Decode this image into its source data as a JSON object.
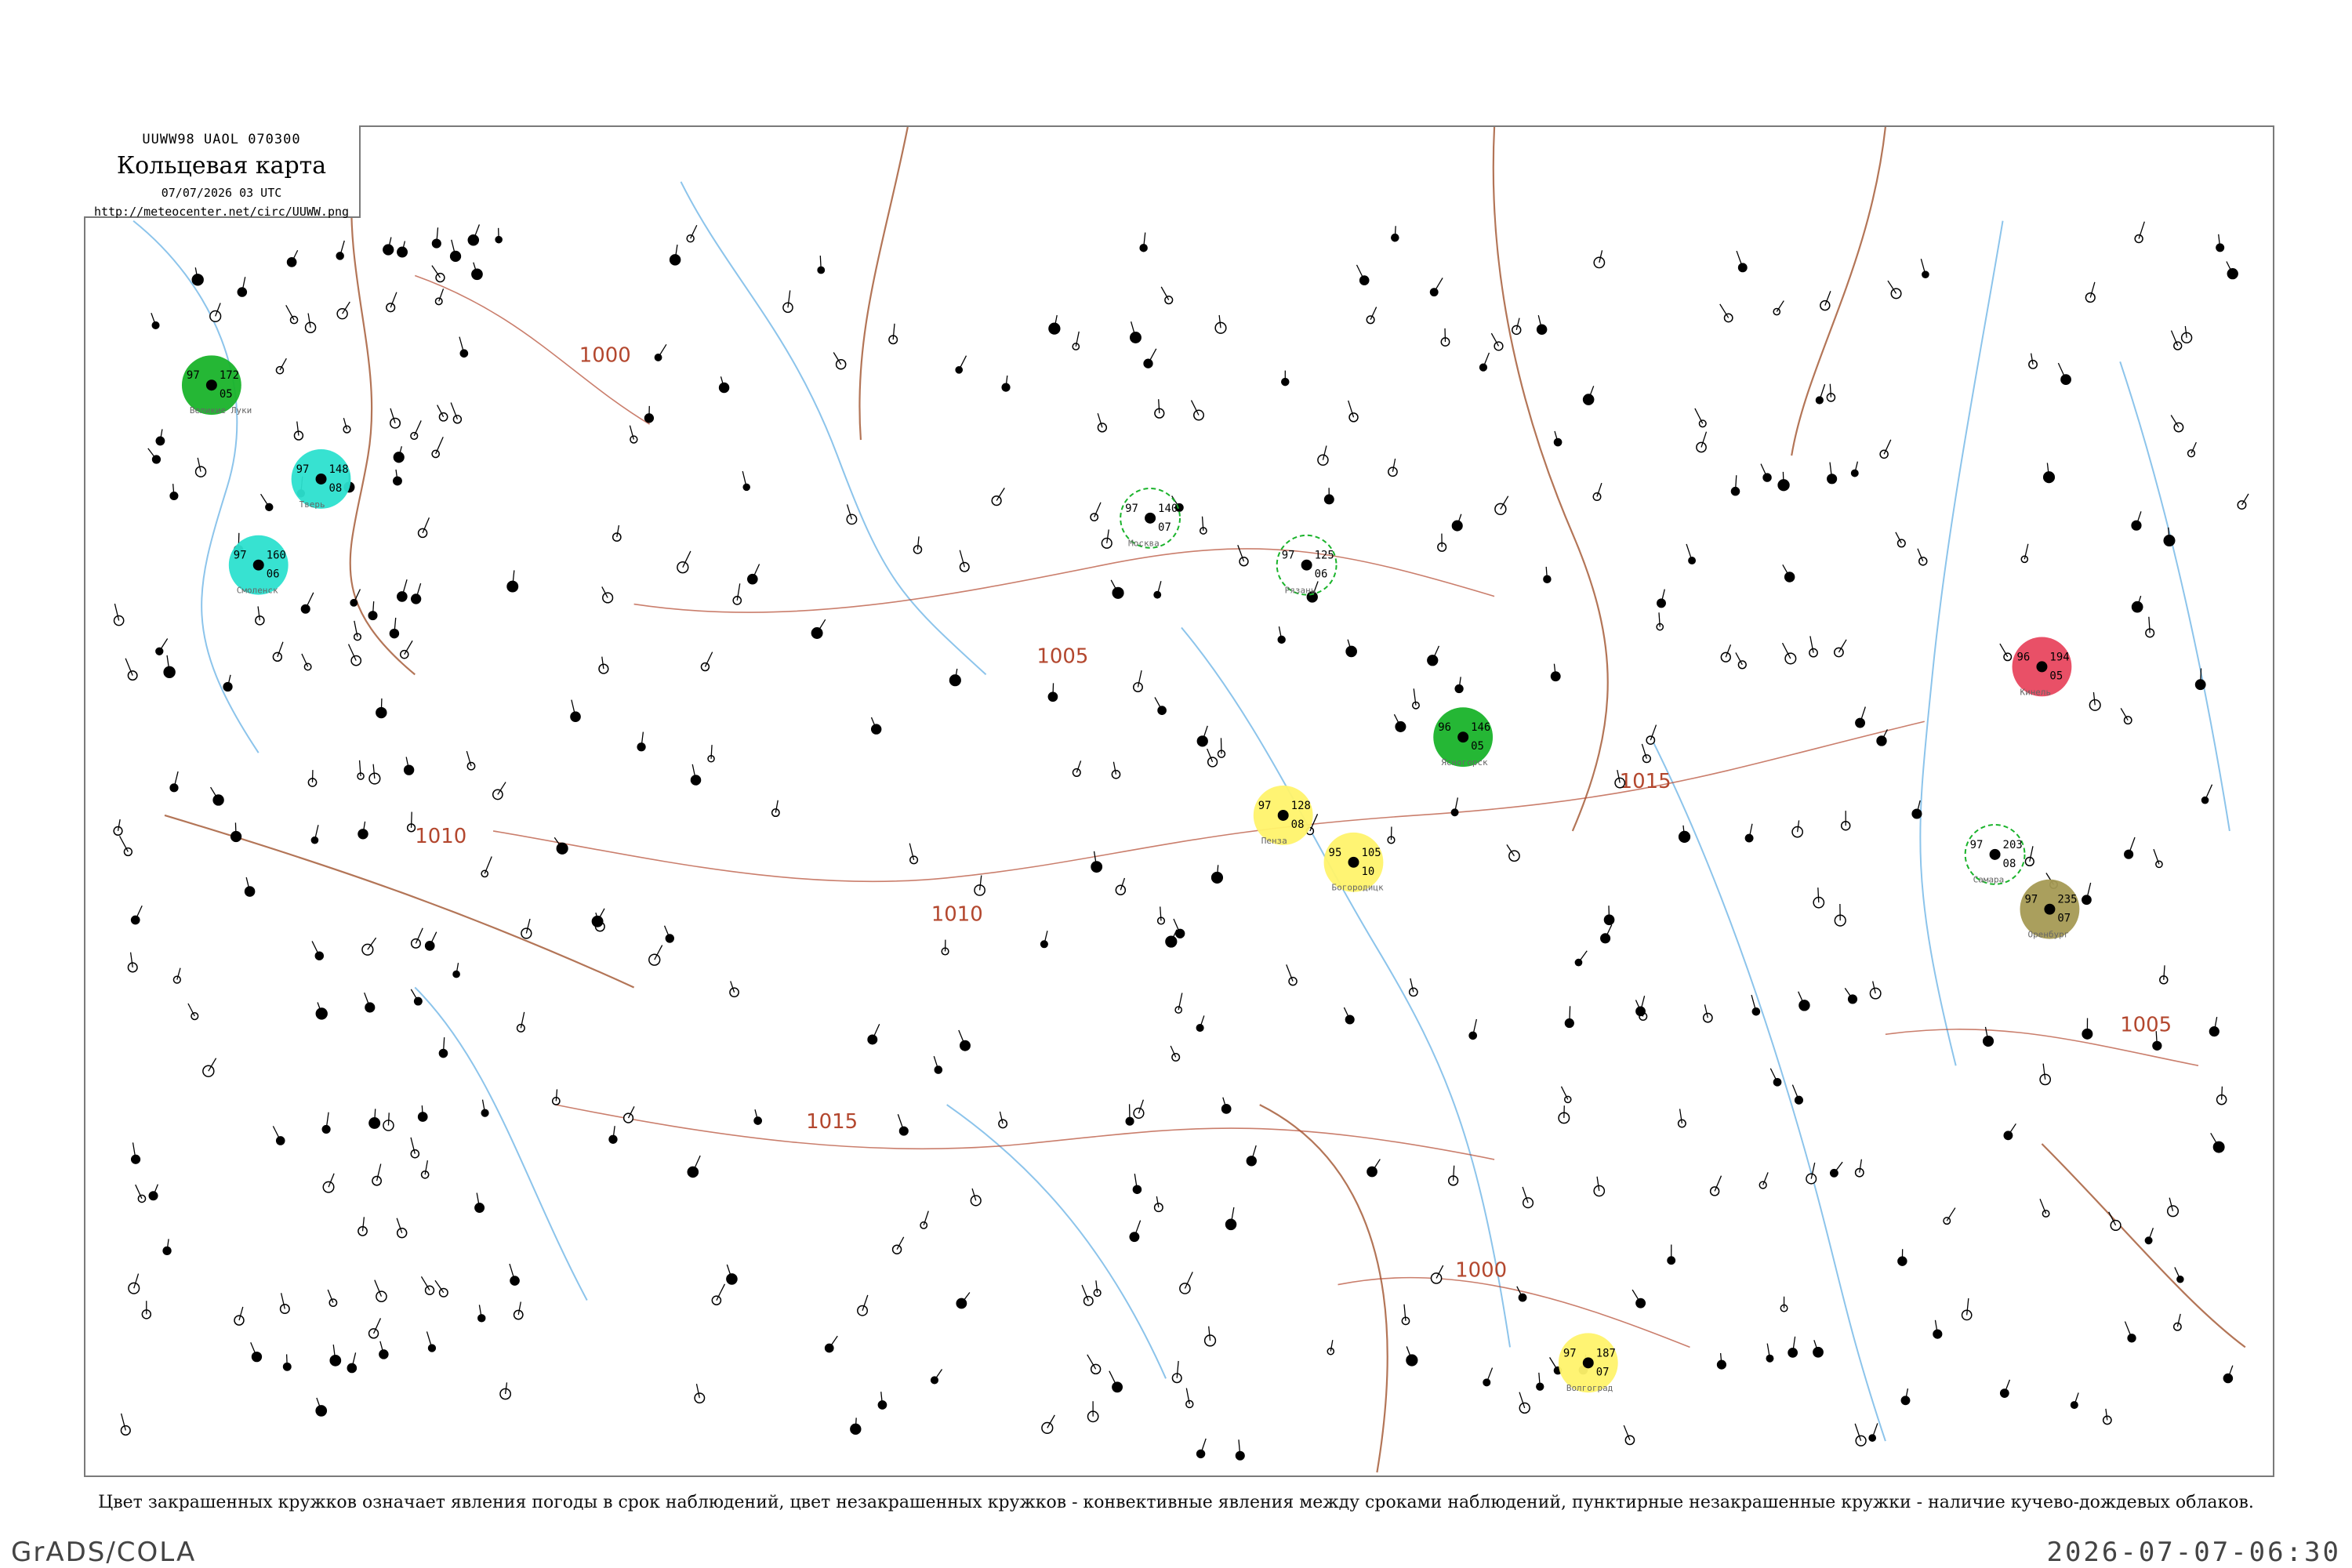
{
  "map": {
    "header_code": "UUWW98  UAOL  070300",
    "title": "Кольцевая карта",
    "datetime": "07/07/2026 03 UTC",
    "url": "http://meteocenter.net/circ/UUWW.png",
    "isobars": [
      "1000",
      "1005",
      "1010",
      "1015"
    ],
    "stations": [
      {
        "name": "Москва",
        "pressure": "140",
        "temp": "97",
        "dew": "07",
        "fill": "#ffffff"
      },
      {
        "name": "Рязань",
        "pressure": "125",
        "temp": "97",
        "dew": "06",
        "fill": "#ffffff"
      },
      {
        "name": "Ясногорск",
        "pressure": "146",
        "temp": "96",
        "dew": "05",
        "fill": "#19b32a"
      },
      {
        "name": "Богородицк",
        "pressure": "105",
        "temp": "95",
        "dew": "10",
        "fill": "#fff36b"
      },
      {
        "name": "Пенза",
        "pressure": "128",
        "temp": "97",
        "dew": "08",
        "fill": "#fff36b"
      },
      {
        "name": "Кинель",
        "pressure": "194",
        "temp": "96",
        "dew": "05",
        "fill": "#e8475f"
      },
      {
        "name": "Тверь",
        "pressure": "148",
        "temp": "97",
        "dew": "08",
        "fill": "#2ce0cf"
      },
      {
        "name": "Смоленск",
        "pressure": "160",
        "temp": "97",
        "dew": "06",
        "fill": "#2ce0cf"
      },
      {
        "name": "Великие Луки",
        "pressure": "172",
        "temp": "97",
        "dew": "05",
        "fill": "#19b32a"
      },
      {
        "name": "Волгоград",
        "pressure": "187",
        "temp": "97",
        "dew": "07",
        "fill": "#fff36b"
      },
      {
        "name": "Самара",
        "pressure": "203",
        "temp": "97",
        "dew": "08",
        "fill": "#ffffff"
      },
      {
        "name": "Оренбург",
        "pressure": "235",
        "temp": "97",
        "dew": "07",
        "fill": "#a59a54"
      }
    ]
  },
  "legend": "Цвет закрашенных кружков означает явления погоды в срок наблюдений, цвет незакрашенных кружков - конвективные явления между сроками наблюдений, пунктирные незакрашенные кружки - наличие кучево-дождевых облаков.",
  "footer": {
    "left": "GrADS/COLA",
    "right": "2026-07-07-06:30"
  },
  "colors": {
    "green": "#19b32a",
    "cyan": "#2ce0cf",
    "yellow": "#fff36b",
    "red": "#e8475f",
    "olive": "#a59a54",
    "river": "#6fb5e6",
    "border": "#a0522d",
    "isobar": "#b3472e"
  }
}
